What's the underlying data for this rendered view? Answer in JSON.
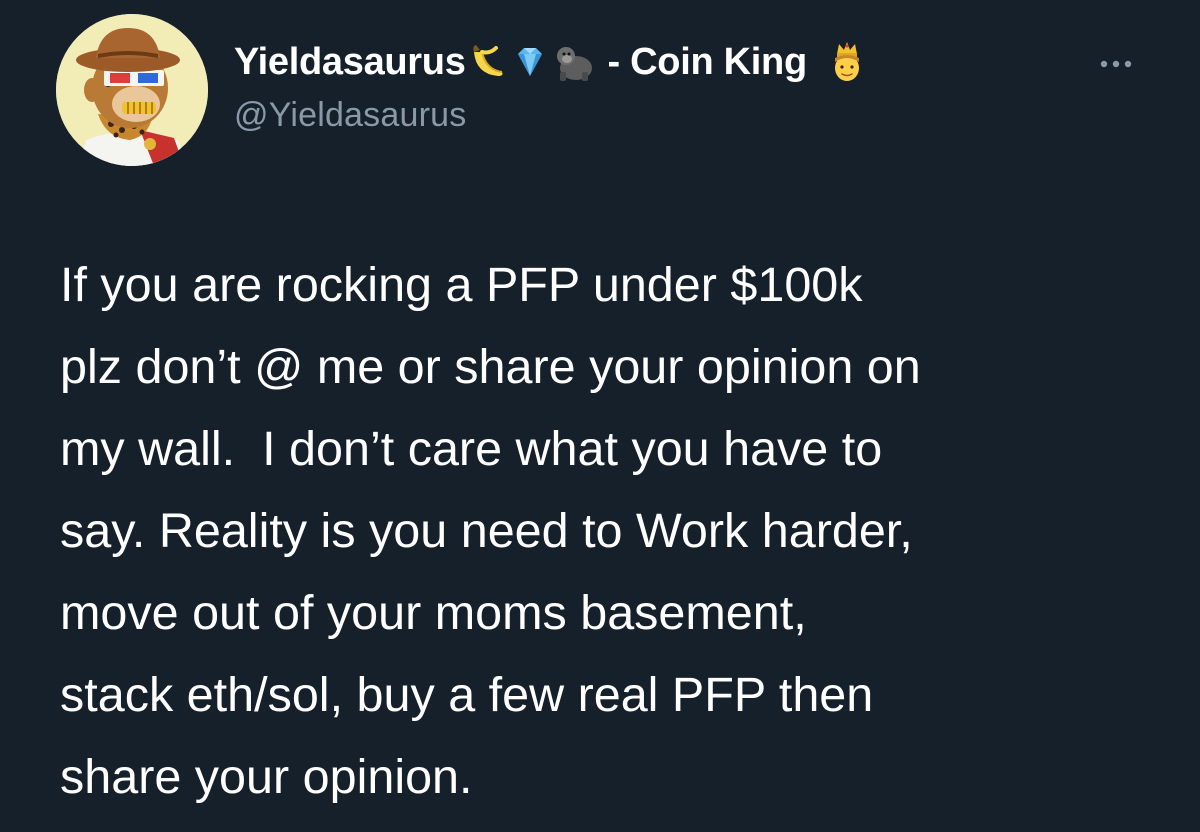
{
  "tweet": {
    "author": {
      "display_name": "Yieldasaurus",
      "name_suffix": "- Coin King",
      "handle": "@Yieldasaurus",
      "avatar_icon": "bored-ape-avatar",
      "name_emojis": [
        "banana-emoji",
        "gem-emoji",
        "gorilla-emoji"
      ],
      "trailing_emoji": "crown-person-emoji"
    },
    "more_icon": "ellipsis-icon",
    "text_lines": [
      "If you are rocking a PFP under $100k",
      "plz don’t @ me or share your opinion on",
      "my wall.  I don’t care what you have to",
      "say. Reality is you need to Work harder,",
      "move out of your moms basement,",
      "stack eth/sol, buy a few real PFP then",
      "share your opinion."
    ]
  },
  "colors": {
    "background": "#15202b",
    "text_primary": "#ffffff",
    "text_secondary": "#8b98a5",
    "avatar_bg": "#f2ecb6"
  }
}
